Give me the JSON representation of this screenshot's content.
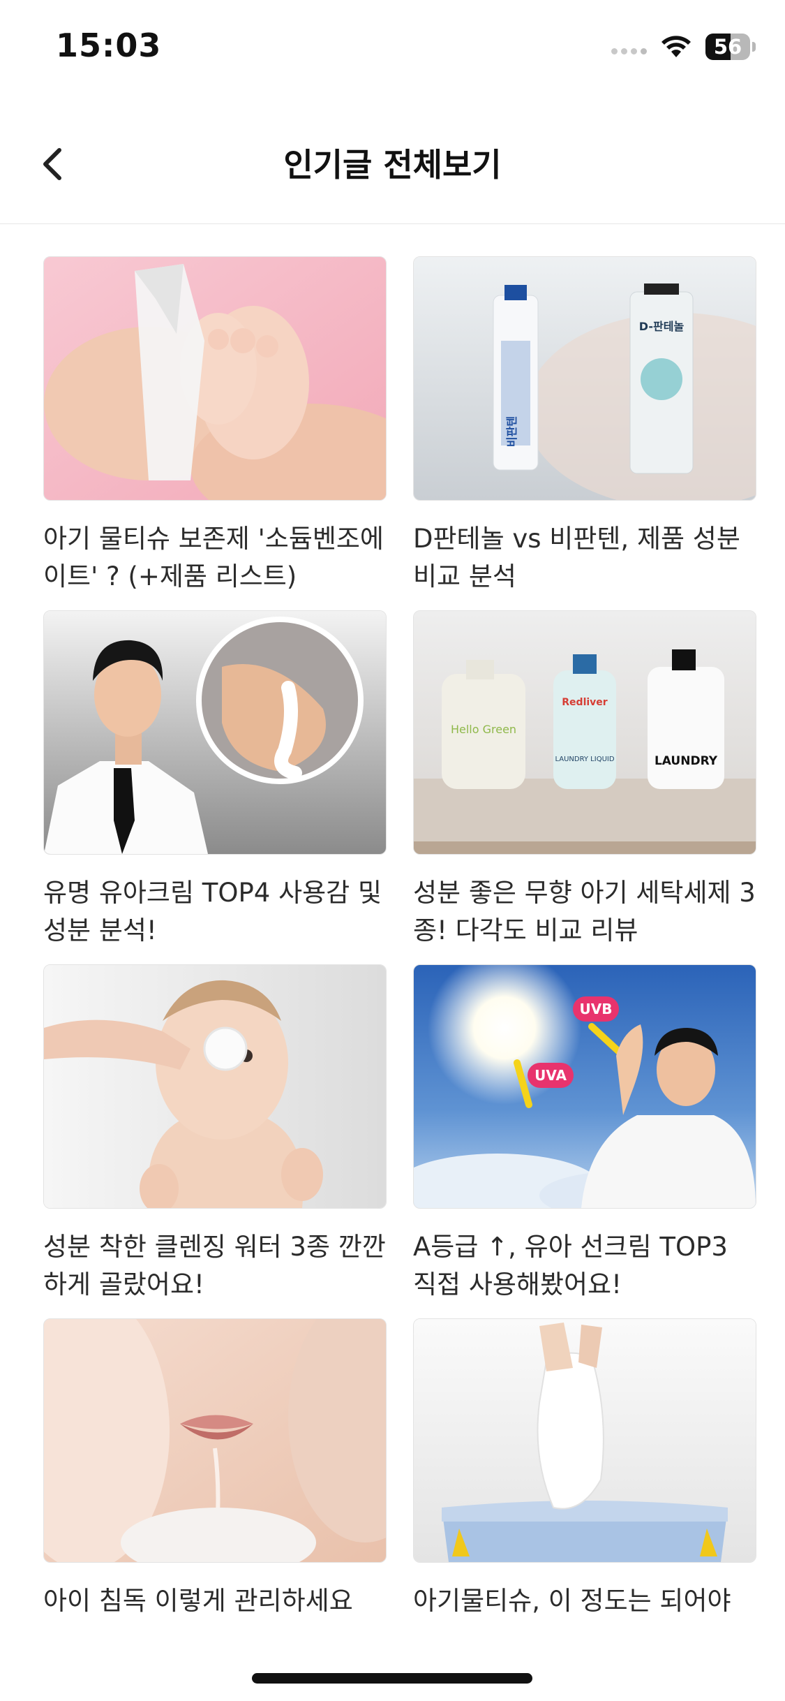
{
  "status_bar": {
    "time": "15:03",
    "battery_level": "56",
    "battery_fraction": 0.56,
    "icons": [
      "cellular-signal-icon",
      "wifi-icon",
      "battery-icon"
    ]
  },
  "header": {
    "title": "인기글 전체보기",
    "back_icon": "chevron-left-icon"
  },
  "posts": [
    {
      "title": "아기 물티슈 보존제 '소듐벤조에이트' ? (+제품 리스트)"
    },
    {
      "title": "D판테놀 vs 비판텐, 제품 성분 비교 분석",
      "image_labels": [
        "D-판테놀",
        "비판텐"
      ]
    },
    {
      "title": "유명 유아크림 TOP4 사용감 및 성분 분석!"
    },
    {
      "title": "성분 좋은 무향 아기 세탁세제 3종! 다각도 비교 리뷰",
      "image_labels": [
        "Hello Green",
        "Redliver",
        "LAUNDRY LIQUID",
        "LAUNDRY"
      ]
    },
    {
      "title": "성분 착한 클렌징 워터 3종 깐깐하게 골랐어요!"
    },
    {
      "title": "A등급 ↑, 유아 선크림 TOP3 직접 사용해봤어요!",
      "image_labels": [
        "UVB",
        "UVA"
      ]
    },
    {
      "title": "아이 침독 이렇게 관리하세요"
    },
    {
      "title": "아기물티슈, 이 정도는 되어야"
    }
  ],
  "colors": {
    "accent_pink": "#e8336d",
    "arrow_yellow": "#f5d31a",
    "divider": "#e6e6e6"
  }
}
